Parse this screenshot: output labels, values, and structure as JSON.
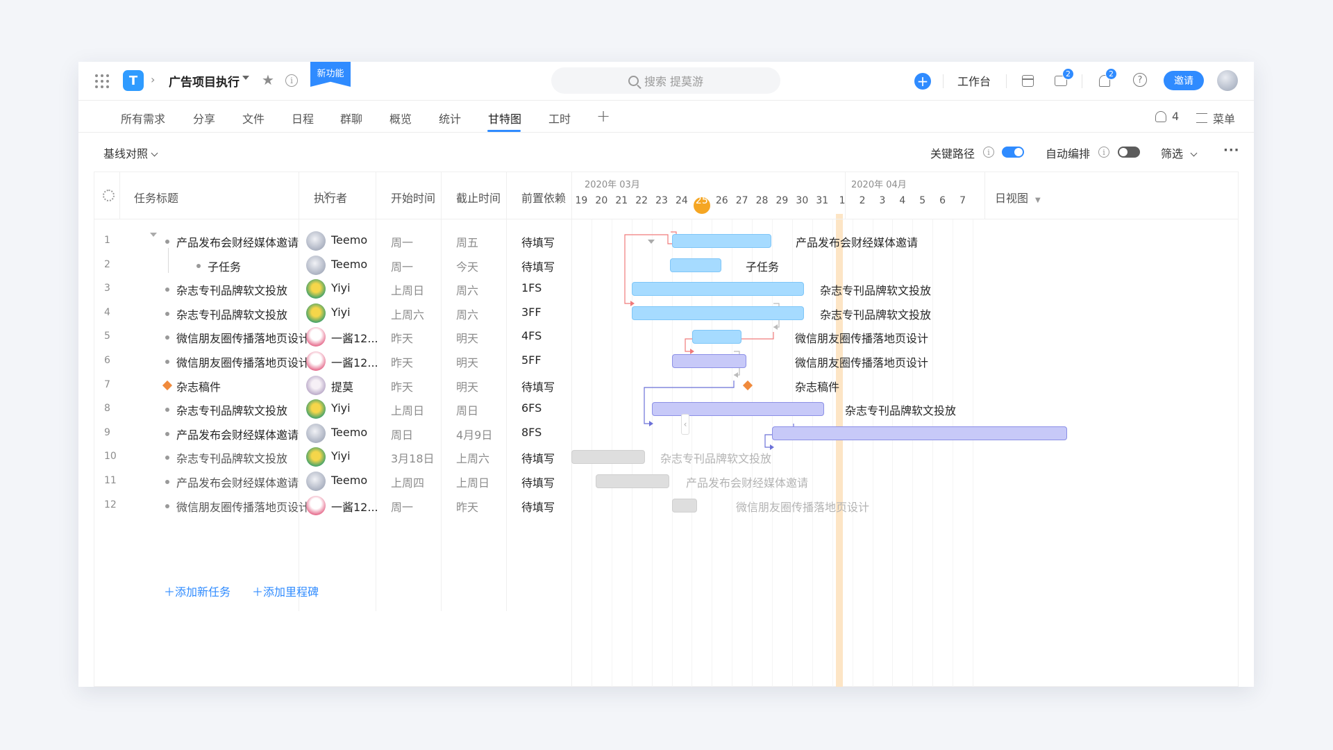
{
  "header": {
    "project_title": "广告项目执行",
    "new_feature_badge": "新功能",
    "search_placeholder": "搜索 提莫游",
    "workbench_label": "工作台",
    "messages_count": "2",
    "notifications_count": "2",
    "invite_label": "邀请"
  },
  "tabs": [
    {
      "label": "所有需求"
    },
    {
      "label": "分享"
    },
    {
      "label": "文件"
    },
    {
      "label": "日程"
    },
    {
      "label": "群聊"
    },
    {
      "label": "概览"
    },
    {
      "label": "统计"
    },
    {
      "label": "甘特图",
      "active": true
    },
    {
      "label": "工时"
    }
  ],
  "tabs_right": {
    "members_count": "4",
    "menu_label": "菜单"
  },
  "toolbar": {
    "baseline_label": "基线对照",
    "critical_path_label": "关键路径",
    "critical_path_on": true,
    "auto_schedule_label": "自动编排",
    "auto_schedule_on": false,
    "filter_label": "筛选",
    "more_label": "···"
  },
  "table": {
    "headers": {
      "title": "任务标题",
      "assignee": "执行者",
      "start": "开始时间",
      "end": "截止时间",
      "deps": "前置依赖"
    },
    "rows": [
      {
        "num": "1",
        "title": "产品发布会财经媒体邀请",
        "assignee": "Teemo",
        "start": "周一",
        "end": "周五",
        "deps": "待填写"
      },
      {
        "num": "2",
        "title": "子任务",
        "assignee": "Teemo",
        "start": "周一",
        "end": "今天",
        "deps": "待填写"
      },
      {
        "num": "3",
        "title": "杂志专刊品牌软文投放",
        "assignee": "Yiyi",
        "start": "上周日",
        "end": "周六",
        "deps": "1FS"
      },
      {
        "num": "4",
        "title": "杂志专刊品牌软文投放",
        "assignee": "Yiyi",
        "start": "上周六",
        "end": "周六",
        "deps": "3FF"
      },
      {
        "num": "5",
        "title": "微信朋友圈传播落地页设计",
        "assignee": "一酱12...",
        "start": "昨天",
        "end": "明天",
        "deps": "4FS"
      },
      {
        "num": "6",
        "title": "微信朋友圈传播落地页设计",
        "assignee": "一酱12...",
        "start": "昨天",
        "end": "明天",
        "deps": "5FF"
      },
      {
        "num": "7",
        "title": "杂志稿件",
        "assignee": "提莫",
        "start": "昨天",
        "end": "明天",
        "deps": "待填写"
      },
      {
        "num": "8",
        "title": "杂志专刊品牌软文投放",
        "assignee": "Yiyi",
        "start": "上周日",
        "end": "周日",
        "deps": "6FS"
      },
      {
        "num": "9",
        "title": "产品发布会财经媒体邀请",
        "assignee": "Teemo",
        "start": "周日",
        "end": "4月9日",
        "deps": "8FS"
      },
      {
        "num": "10",
        "title": "杂志专刊品牌软文投放",
        "assignee": "Yiyi",
        "start": "3月18日",
        "end": "上周六",
        "deps": "待填写"
      },
      {
        "num": "11",
        "title": "产品发布会财经媒体邀请",
        "assignee": "Teemo",
        "start": "上周四",
        "end": "上周日",
        "deps": "待填写"
      },
      {
        "num": "12",
        "title": "微信朋友圈传播落地页设计",
        "assignee": "一酱12...",
        "start": "周一",
        "end": "昨天",
        "deps": "待填写"
      }
    ],
    "add_task_label": "添加新任务",
    "add_milestone_label": "添加里程碑"
  },
  "timeline": {
    "month1": "2020年 03月",
    "month2": "2020年 04月",
    "days": [
      "19",
      "20",
      "21",
      "22",
      "23",
      "24",
      "25",
      "26",
      "27",
      "28",
      "29",
      "30",
      "31",
      "1",
      "2",
      "3",
      "4",
      "5",
      "6",
      "7"
    ],
    "today": "25",
    "view_mode": "日视图",
    "bars": [
      {
        "label": "产品发布会财经媒体邀请"
      },
      {
        "label": "子任务"
      },
      {
        "label": "杂志专刊品牌软文投放"
      },
      {
        "label": "杂志专刊品牌软文投放"
      },
      {
        "label": "微信朋友圈传播落地页设计"
      },
      {
        "label": "微信朋友圈传播落地页设计"
      },
      {
        "label": "杂志稿件"
      },
      {
        "label": "杂志专刊品牌软文投放"
      },
      {
        "label": ""
      },
      {
        "label": "杂志专刊品牌软文投放"
      },
      {
        "label": "产品发布会财经媒体邀请"
      },
      {
        "label": "微信朋友圈传播落地页设计"
      }
    ]
  }
}
